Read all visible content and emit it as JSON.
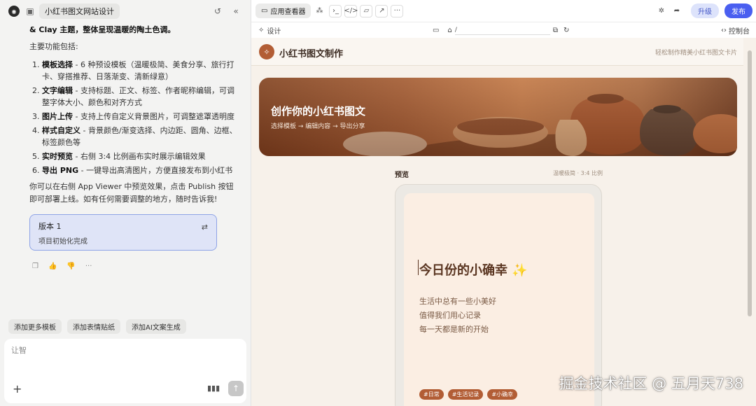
{
  "sidebar": {
    "title": "小红书图文网站设计",
    "intro_partial": "& Clay 主题，整体呈现温暖的陶土色调。",
    "features_heading": "主要功能包括:",
    "features": [
      {
        "num": "1.",
        "name": "模板选择",
        "desc": " - 6 种预设模板（温暖极简、美食分享、旅行打卡、穿搭推荐、日落渐变、清新绿意）"
      },
      {
        "num": "2.",
        "name": "文字编辑",
        "desc": " - 支持标题、正文、标签、作者昵称编辑，可调整字体大小、颜色和对齐方式"
      },
      {
        "num": "3.",
        "name": "图片上传",
        "desc": " - 支持上传自定义背景图片，可调整遮罩透明度"
      },
      {
        "num": "4.",
        "name": "样式自定义",
        "desc": " - 背景颜色/渐变选择、内边距、圆角、边框、标签颜色等"
      },
      {
        "num": "5.",
        "name": "实时预览",
        "desc": " - 右侧 3:4 比例画布实时展示编辑效果"
      },
      {
        "num": "6.",
        "name": "导出 PNG",
        "desc": " - 一键导出高清图片，方便直接发布到小红书"
      }
    ],
    "outro": "你可以在右侧 App Viewer 中预览效果，点击 Publish 按钮即可部署上线。如有任何需要调整的地方，随时告诉我!",
    "version_title": "版本 1",
    "version_desc": "项目初始化完成",
    "suggestions": [
      "添加更多模板",
      "添加表情贴纸",
      "添加AI文案生成"
    ],
    "composer_placeholder": "让智"
  },
  "toolbar": {
    "tab_label": "应用查看器",
    "upgrade": "升级",
    "publish": "发布",
    "design": "设计",
    "url": "/",
    "console": "控制台"
  },
  "app": {
    "title": "小红书图文制作",
    "tagline": "轻松制作精美小红书图文卡片",
    "hero_title": "创作你的小红书图文",
    "hero_sub": "选择模板 → 编辑内容 → 导出分享",
    "preview_label": "预览",
    "preview_meta": "温暖极简 · 3:4 比例",
    "card_title": "今日份的小确幸 ✨",
    "card_lines": [
      "生活中总有一些小美好",
      "值得我们用心记录",
      "每一天都是新的开始"
    ],
    "tags": [
      "#日常",
      "#生活记录",
      "#小确幸"
    ]
  },
  "watermark": "掘金技术社区 @ 五月天738",
  "colors": {
    "accent": "#4a5ff0",
    "brand": "#b25d35",
    "version_bg": "#dfe4f7"
  }
}
